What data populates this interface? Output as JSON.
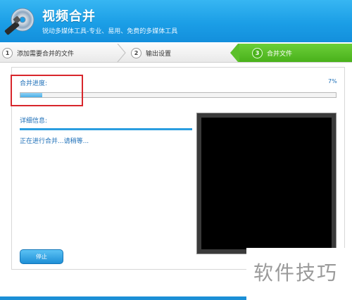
{
  "header": {
    "title": "视频合并",
    "subtitle": "锐动多媒体工具-专业、易用、免费的多媒体工具"
  },
  "steps": [
    {
      "number": "1",
      "label": "添加需要合并的文件",
      "state": "done"
    },
    {
      "number": "2",
      "label": "输出设置",
      "state": "done"
    },
    {
      "number": "3",
      "label": "合并文件",
      "state": "active"
    }
  ],
  "progress": {
    "label": "合并进度:",
    "percent_text": "7%",
    "value": 0.07
  },
  "details": {
    "label": "详细信息:",
    "text": "正在进行合并...请稍等..."
  },
  "buttons": {
    "stop": "停止"
  },
  "watermark": "软件技巧",
  "colors": {
    "header": "#1b9ee6",
    "active_step": "#49b11b",
    "accent_text": "#1d6fb8",
    "highlight": "#d8262c"
  },
  "icons": {
    "logo": "media-disc-wand-icon"
  }
}
